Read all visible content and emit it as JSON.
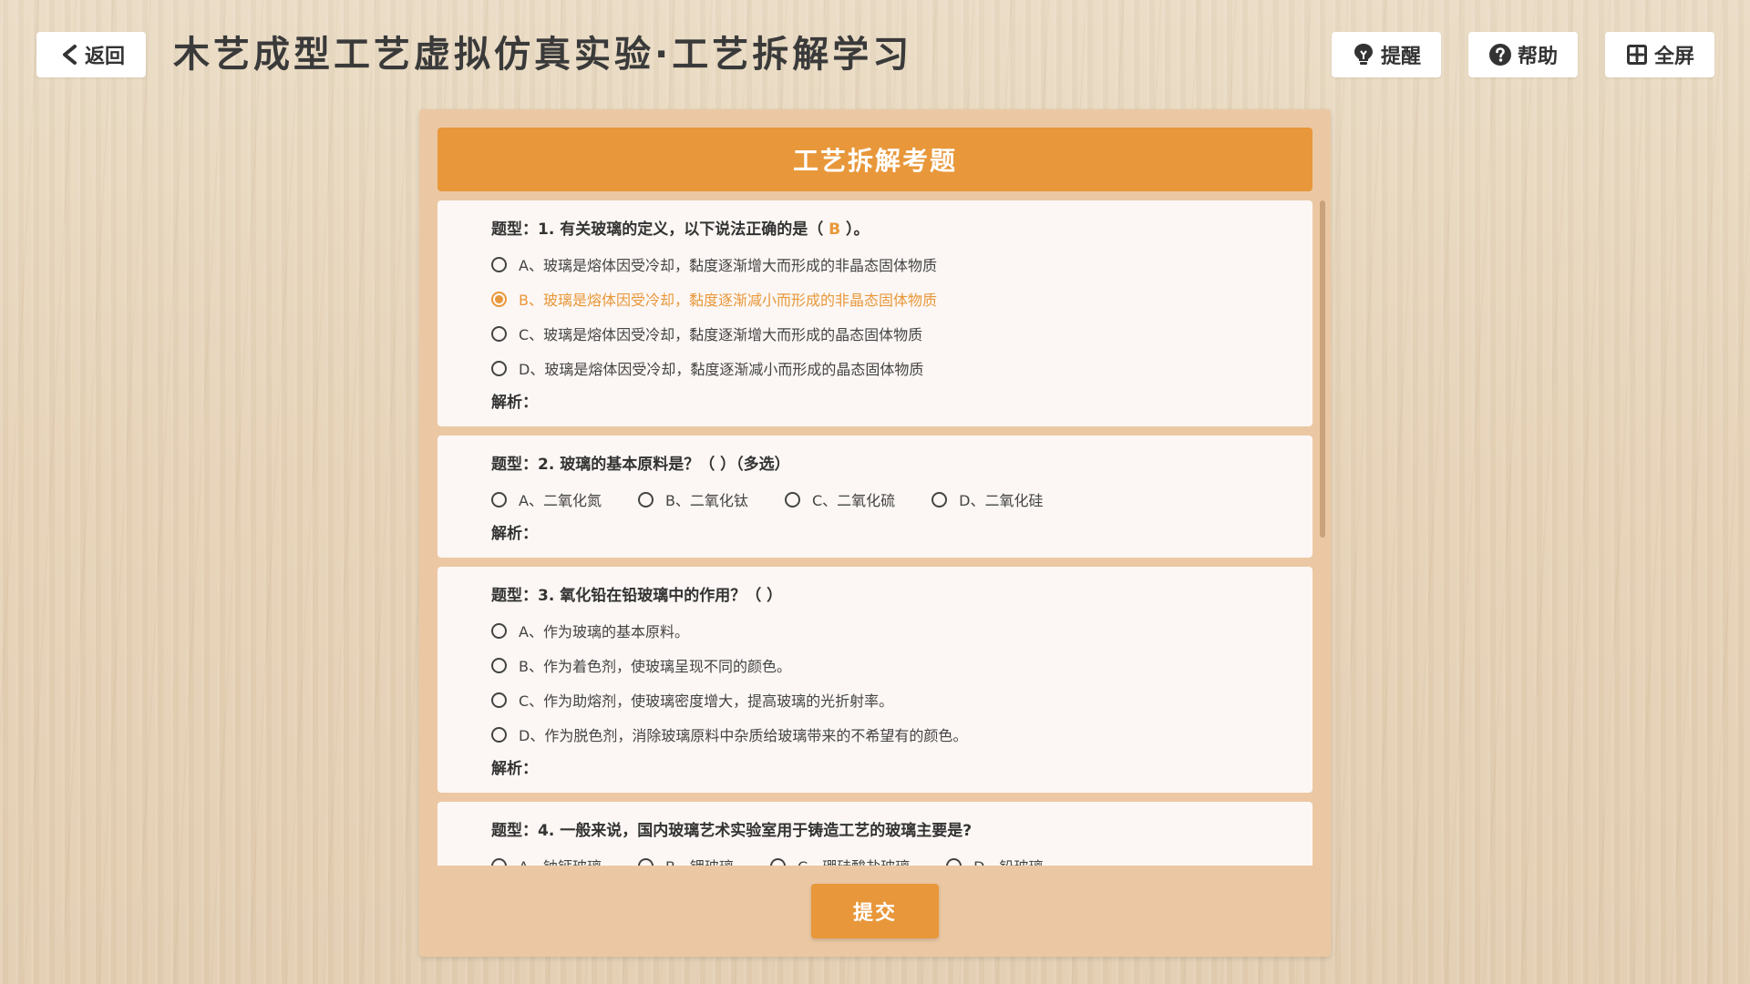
{
  "header": {
    "back_label": "返回",
    "title": "木艺成型工艺虚拟仿真实验·工艺拆解学习",
    "remind_label": "提醒",
    "help_label": "帮助",
    "fullscreen_label": "全屏"
  },
  "panel": {
    "title": "工艺拆解考题",
    "submit_label": "提交"
  },
  "questions": [
    {
      "prefix": "题型：1. 有关玻璃的定义，以下说法正确的是（ ",
      "answer": "B",
      "suffix": " ）。",
      "options": [
        "A、玻璃是熔体因受冷却，黏度逐渐增大而形成的非晶态固体物质",
        "B、玻璃是熔体因受冷却，黏度逐渐减小而形成的非晶态固体物质",
        "C、玻璃是熔体因受冷却，黏度逐渐增大而形成的晶态固体物质",
        "D、玻璃是熔体因受冷却，黏度逐渐减小而形成的晶态固体物质"
      ],
      "selected": "B",
      "analysis": "解析："
    },
    {
      "title": "题型：2. 玻璃的基本原料是？（   ）（多选）",
      "options": [
        "A、二氧化氮",
        "B、二氧化钛",
        "C、二氧化硫",
        "D、二氧化硅"
      ],
      "analysis": "解析："
    },
    {
      "title": "题型：3. 氧化铅在铅玻璃中的作用？（   ）",
      "options": [
        "A、作为玻璃的基本原料。",
        "B、作为着色剂，使玻璃呈现不同的颜色。",
        "C、作为助熔剂，使玻璃密度增大，提高玻璃的光折射率。",
        "D、作为脱色剂，消除玻璃原料中杂质给玻璃带来的不希望有的颜色。"
      ],
      "analysis": "解析："
    },
    {
      "title": "题型：4. 一般来说，国内玻璃艺术实验室用于铸造工艺的玻璃主要是?",
      "options": [
        "A、钠钙玻璃",
        "B、钾玻璃",
        "C、硼硅酸盐玻璃",
        "D、铅玻璃"
      ]
    }
  ],
  "colors": {
    "accent": "#e8973a",
    "panel_bg": "#ebc8a3",
    "card_bg": "#fcf7f4",
    "text": "#333333"
  },
  "icons": {
    "back": "chevron-left-icon",
    "remind": "lightbulb-icon",
    "help": "question-circle-icon",
    "fullscreen": "fullscreen-plus-icon"
  }
}
